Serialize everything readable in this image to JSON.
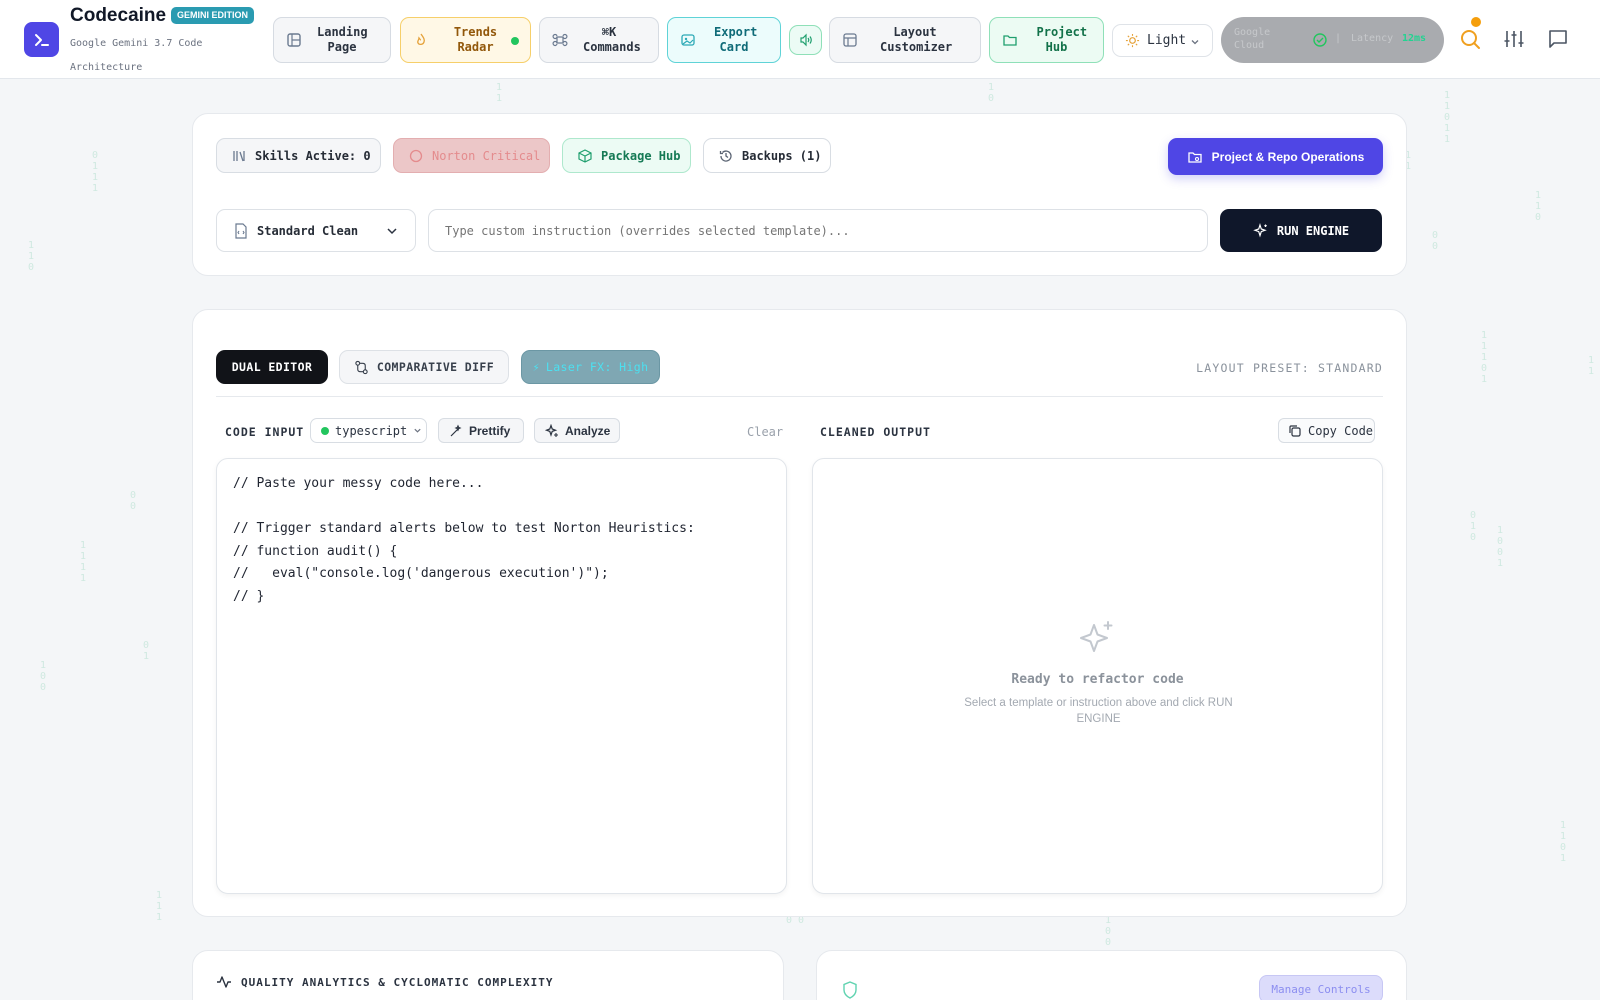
{
  "app": {
    "name": "Codecaine",
    "edition_badge": "GEMINI EDITION",
    "subtitle": "Google Gemini 3.7 Code Architecture"
  },
  "nav": {
    "landing_page": "Landing Page",
    "trends_radar": "Trends Radar",
    "commands": "⌘K Commands",
    "export_card": "Export Card",
    "layout_customizer": "Layout Customizer",
    "project_hub": "Project Hub",
    "theme": "Light",
    "cloud_status": "Google Cloud",
    "latency_label": "Latency",
    "latency_value": "12ms"
  },
  "toolbar": {
    "skills_active": "Skills Active: 0",
    "norton_critical": "Norton Critical",
    "package_hub": "Package Hub",
    "backups": "Backups (1)",
    "project_repo_ops": "Project & Repo Operations",
    "template_selected": "Standard Clean",
    "instruction_placeholder": "Type custom instruction (overrides selected template)...",
    "run_engine": "RUN ENGINE"
  },
  "editor": {
    "tab_dual": "DUAL EDITOR",
    "tab_diff": "COMPARATIVE DIFF",
    "laser_fx": "Laser FX: High",
    "layout_preset": "LAYOUT PRESET: STANDARD",
    "code_input_label": "CODE INPUT",
    "language": "typescript",
    "prettify": "Prettify",
    "analyze": "Analyze",
    "clear": "Clear",
    "output_label": "CLEANED OUTPUT",
    "copy_code": "Copy Code",
    "code_lines": [
      "// Paste your messy code here...",
      "",
      "// Trigger standard alerts below to test Norton Heuristics:",
      "// function audit() {",
      "//   eval(\"console.log('dangerous execution')\");",
      "// }"
    ],
    "empty_title": "Ready to refactor code",
    "empty_hint": "Select a template or instruction above and click RUN ENGINE"
  },
  "bottom": {
    "quality_title": "QUALITY ANALYTICS & CYCLOMATIC COMPLEXITY",
    "manage_controls": "Manage Controls"
  },
  "colors": {
    "accent": "#4f46e5",
    "run_button": "#0f172a",
    "status_green": "#22c55e",
    "notification": "#f59e0b"
  }
}
